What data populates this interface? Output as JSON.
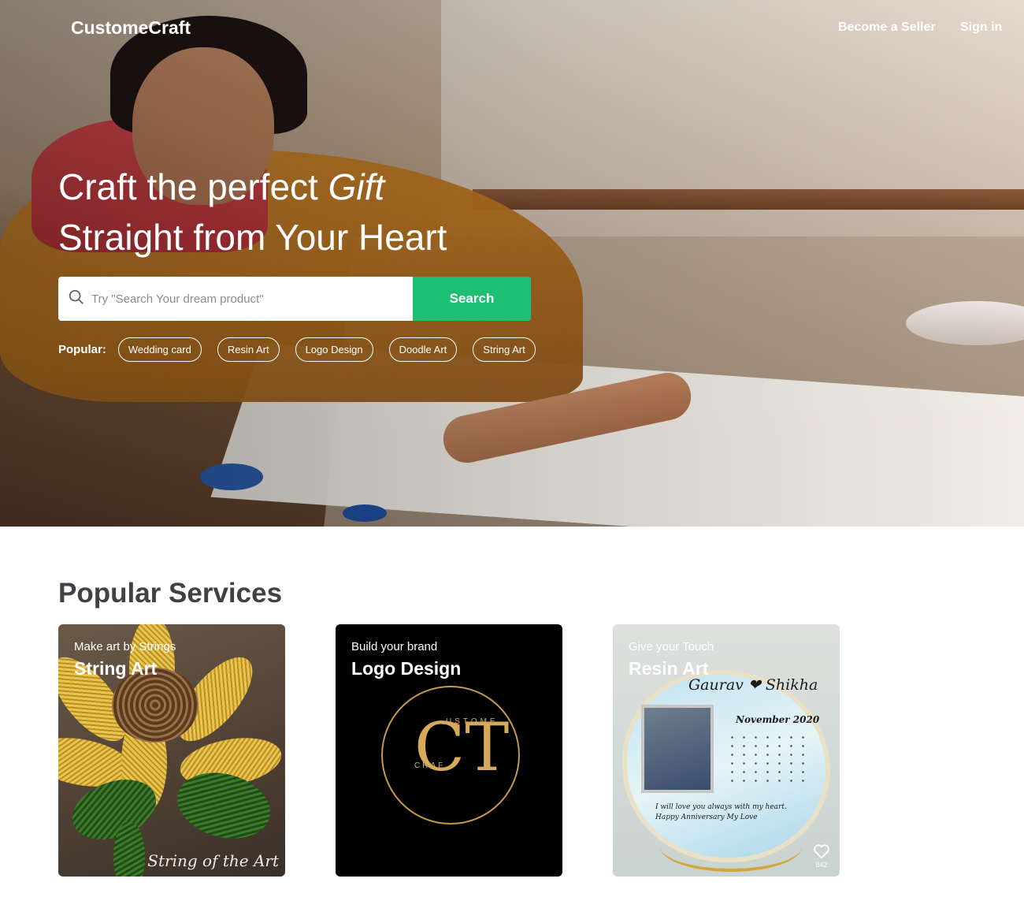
{
  "header": {
    "brand": "CustomeCraft",
    "nav": [
      {
        "label": "Become a Seller"
      },
      {
        "label": "Sign in"
      }
    ]
  },
  "hero": {
    "headline_line1_plain": "Craft the perfect ",
    "headline_line1_italic": "Gift",
    "headline_line2": "Straight from Your Heart",
    "search": {
      "placeholder": "Try \"Search Your dream product\"",
      "value": "",
      "button_label": "Search",
      "icon": "search-icon"
    },
    "popular": {
      "label": "Popular:",
      "chips": [
        "Wedding card",
        "Resin Art",
        "Logo Design",
        "Doodle Art",
        "String Art"
      ]
    }
  },
  "popular_services": {
    "title": "Popular Services",
    "cards": [
      {
        "subtitle": "Make art by Strings",
        "title": "String Art",
        "watermark": "String of the Art"
      },
      {
        "subtitle": "Build your brand",
        "title": "Logo Design",
        "monogram": "CT",
        "brand_top": "USTOME",
        "brand_bottom": "CRAF"
      },
      {
        "subtitle": "Give your Touch",
        "title": "Resin Art",
        "names": "Gaurav ❤ Shikha",
        "month": "November 2020",
        "note_line1": "I will love you always with my heart.",
        "note_line2": "Happy Anniversary My Love",
        "likes": "842",
        "like_icon": "heart-icon"
      }
    ]
  },
  "colors": {
    "accent": "#1dbf73",
    "heading": "#404145",
    "white": "#ffffff"
  }
}
